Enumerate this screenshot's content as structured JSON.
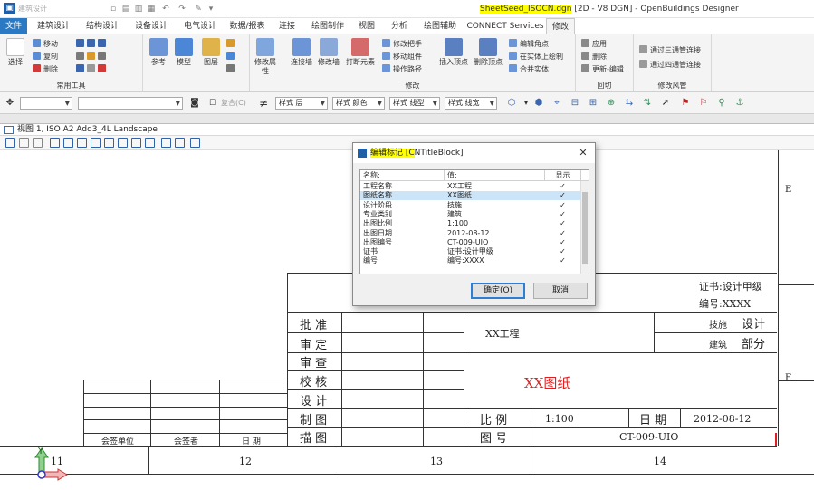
{
  "titlebar": {
    "workflow": "建筑设计",
    "filename": "SheetSeed_ISOCN.dgn",
    "title_rest": " [2D - V8 DGN] - OpenBuildings Designer"
  },
  "tabs": [
    {
      "label": "文件"
    },
    {
      "label": "建筑设计"
    },
    {
      "label": "结构设计"
    },
    {
      "label": "设备设计"
    },
    {
      "label": "电气设计"
    },
    {
      "label": "数据/报表"
    },
    {
      "label": "连接"
    },
    {
      "label": "绘图制作"
    },
    {
      "label": "视图"
    },
    {
      "label": "分析"
    },
    {
      "label": "绘图辅助"
    },
    {
      "label": "CONNECT Services"
    },
    {
      "label": "修改"
    }
  ],
  "ribbon": {
    "common_tools": {
      "label": "常用工具",
      "select": "选择",
      "move": "移动",
      "copy": "复制",
      "delete": "删除",
      "reference": "参考",
      "model": "模型",
      "level": "图层"
    },
    "modify": {
      "label": "修改",
      "modify_props": "修改属性",
      "connect_walls": "连接墙",
      "modify_wall": "修改墙",
      "break_element": "打断元素",
      "modify_handle": "修改把手",
      "move_component": "移动组件",
      "operate_path": "操作路径",
      "insert_vertex": "插入顶点",
      "delete_vertex": "删除顶点",
      "edit_corner": "编辑角点",
      "draw_on_solid": "在实体上绘制",
      "merge_solid": "合并实体"
    },
    "clip": {
      "label": "回切",
      "apply": "应用",
      "delete": "删除",
      "update_edit": "更新-编辑"
    },
    "modify_style": {
      "label": "修改风管",
      "three_way": "通过三通管连接",
      "four_way": "通过四通管连接"
    }
  },
  "attrbar": {
    "composite_label": "复合(C)",
    "style_level": "样式 层",
    "style_color": "样式 颜色",
    "style_linetype": "样式 线型",
    "style_lineweight": "样式 线宽"
  },
  "view": {
    "title": "视图 1, ISO A2 Add3_4L Landscape"
  },
  "drawing": {
    "row_markers": [
      "E",
      "F"
    ],
    "col_numbers": [
      "11",
      "12",
      "13",
      "14"
    ],
    "cert": "证书:设计甲级",
    "number": "编号:XXXX",
    "left_labels": [
      "批 准",
      "审 定",
      "审 查",
      "校 核",
      "设 计",
      "制 图",
      "描 图"
    ],
    "project": "XX工程",
    "phase_label": "技施",
    "phase_value": "设计",
    "discipline_label": "建筑",
    "discipline_value": "部分",
    "drawing_name": "XX图纸",
    "scale_label": "比 例",
    "scale_value": "1:100",
    "date_label": "日 期",
    "date_value": "2012-08-12",
    "drawing_no_label": "图 号",
    "drawing_no_value": "CT-009-UIO",
    "countersign_unit": "会签单位",
    "countersigner": "会签者",
    "cs_date": "日  期",
    "axis_y": "Y"
  },
  "dialog": {
    "title_prefix": "编辑标记",
    "title_highlight": " [C",
    "title_rest": "NTitleBlock]",
    "col_name": "名称:",
    "col_value": "值:",
    "col_show": "显示",
    "rows": [
      {
        "name": "工程名称",
        "value": "XX工程",
        "show": "✓"
      },
      {
        "name": "图纸名称",
        "value": "XX图纸",
        "show": "✓"
      },
      {
        "name": "设计阶段",
        "value": "技施",
        "show": "✓"
      },
      {
        "name": "专业类别",
        "value": "建筑",
        "show": "✓"
      },
      {
        "name": "出图比例",
        "value": "1:100",
        "show": "✓"
      },
      {
        "name": "出图日期",
        "value": "2012-08-12",
        "show": "✓"
      },
      {
        "name": "出图编号",
        "value": "CT-009-UIO",
        "show": "✓"
      },
      {
        "name": "证书",
        "value": "证书:设计甲级",
        "show": "✓"
      },
      {
        "name": "编号",
        "value": "编号:XXXX",
        "show": "✓"
      }
    ],
    "ok_label": "确定(O)",
    "cancel_label": "取消"
  }
}
